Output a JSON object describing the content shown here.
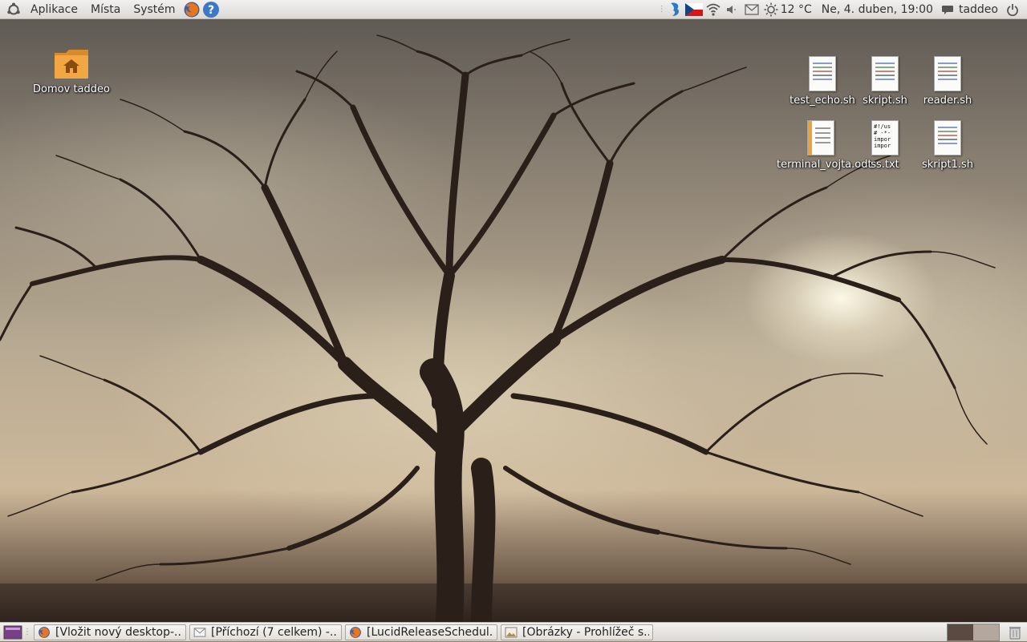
{
  "top_panel": {
    "menus": [
      "Aplikace",
      "Místa",
      "Systém"
    ],
    "launchers": [
      {
        "name": "firefox-icon"
      },
      {
        "name": "help-icon",
        "glyph": "?"
      }
    ],
    "weather": "12 °C",
    "clock": "Ne,  4. duben, 19:00",
    "user": "taddeo"
  },
  "desktop": {
    "home_icon_label": "Domov taddeo",
    "files": [
      {
        "label": "test_echo.sh",
        "type": "script"
      },
      {
        "label": "skript.sh",
        "type": "script"
      },
      {
        "label": "reader.sh",
        "type": "script"
      },
      {
        "label": "terminal_vojta.odt",
        "type": "odt"
      },
      {
        "label": "ss.txt",
        "type": "text",
        "preview": "#!/us\n# -*-\nimpor\nimpor"
      },
      {
        "label": "skript1.sh",
        "type": "script"
      }
    ]
  },
  "taskbar": {
    "tasks": [
      {
        "label": "[Vložit nový desktop-...",
        "icon": "firefox-icon"
      },
      {
        "label": "[Příchozí (7 celkem) -...",
        "icon": "mail-icon"
      },
      {
        "label": "[LucidReleaseSchedul...",
        "icon": "firefox-icon"
      },
      {
        "label": "[Obrázky - Prohlížeč s...",
        "icon": "image-viewer-icon"
      }
    ],
    "workspace_colors": [
      "#5a4a42",
      "#b3a79e"
    ]
  }
}
